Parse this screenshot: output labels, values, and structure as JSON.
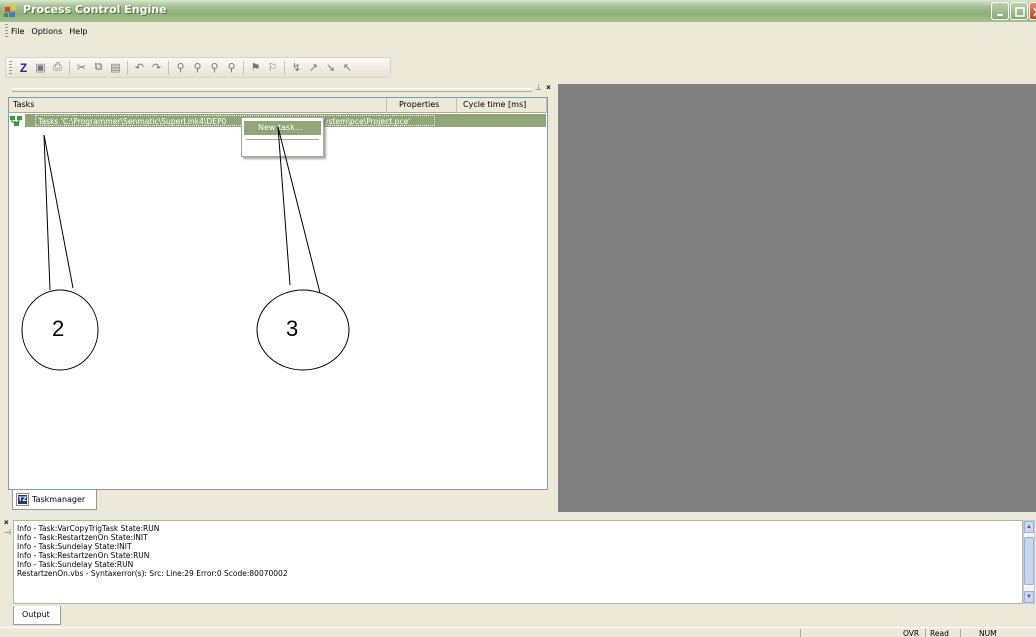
{
  "window": {
    "title": "Process Control Engine"
  },
  "menu": {
    "file": "File",
    "options": "Options",
    "help": "Help"
  },
  "toolbar": {
    "icons": [
      "z-icon",
      "save-icon",
      "print-icon",
      "cut-icon",
      "copy-icon",
      "paste-icon",
      "undo-icon",
      "redo-icon",
      "find-icon",
      "find-next-icon",
      "replace-icon",
      "find-in-files-icon",
      "bookmark-icon",
      "bookmark-next-icon",
      "breakpoint-icon",
      "step-icon",
      "step-into-icon",
      "step-out-icon"
    ]
  },
  "tasks_panel": {
    "columns": {
      "tasks": "Tasks",
      "properties": "Properties",
      "cycle_time": "Cycle time [ms]"
    },
    "root_item_left": "Tasks 'C:\\Programmer\\Senmatic\\SuperLink4\\DEP0",
    "root_item_right": "system\\pce\\Project.pce'",
    "context_menu": {
      "new_task": "New task..."
    },
    "tab": "Taskmanager"
  },
  "annotations": {
    "callout_2": "2",
    "callout_3": "3"
  },
  "output": {
    "lines": [
      "Info - Task:VarCopyTrigTask State:RUN",
      "Info - Task:RestartzenOn State:INIT",
      "Info - Task:Sundelay State:INIT",
      "Info - Task:RestartzenOn State:RUN",
      "Info - Task:Sundelay State:RUN",
      "RestartzenOn.vbs - Syntaxerror(s): Src: Line:29 Error:0 Scode:80070002"
    ],
    "tab": "Output"
  },
  "statusbar": {
    "ovr": "OVR",
    "read": "Read",
    "num": "NUM"
  }
}
